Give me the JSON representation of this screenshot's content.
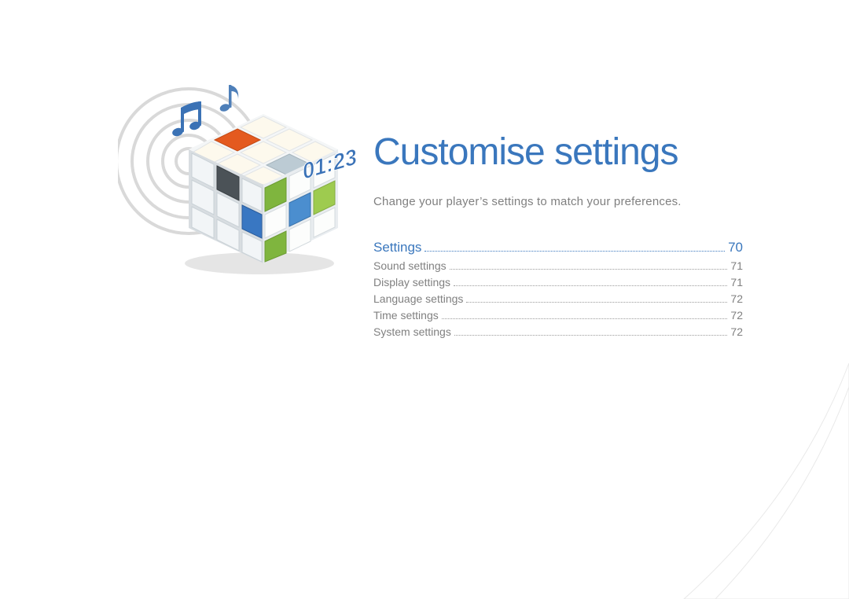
{
  "header": {
    "title": "Customise settings",
    "subtitle": "Change your player’s settings to match your preferences."
  },
  "illustration": {
    "time_label": "01:23"
  },
  "toc": {
    "section": {
      "label": "Settings",
      "page": "70"
    },
    "entries": [
      {
        "label": "Sound settings",
        "page": "71"
      },
      {
        "label": "Display settings",
        "page": "71"
      },
      {
        "label": "Language settings",
        "page": "72"
      },
      {
        "label": "Time settings",
        "page": "72"
      },
      {
        "label": "System settings",
        "page": "72"
      }
    ]
  }
}
